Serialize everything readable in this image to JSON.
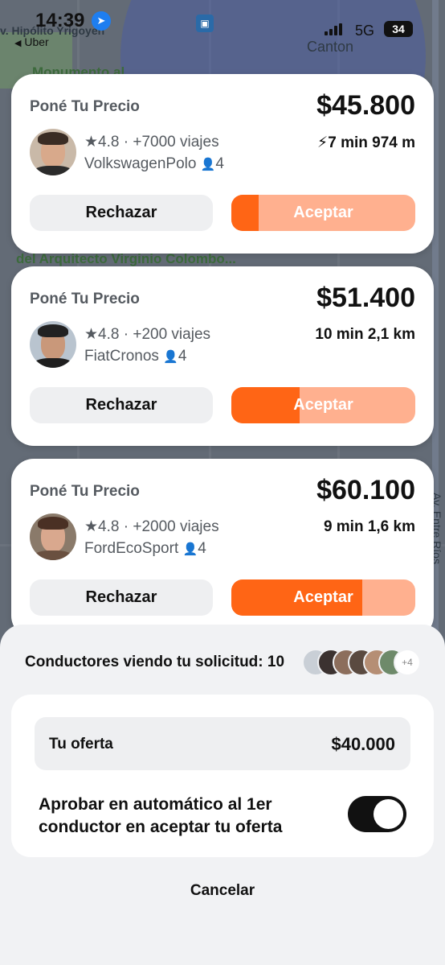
{
  "status_bar": {
    "time": "14:39",
    "back_label": "Uber",
    "network": "5G",
    "battery": "34"
  },
  "map": {
    "labels": {
      "street_top": "v. Hipólito Yrigoyen",
      "canton": "Canton",
      "monument": "Monumento al",
      "architect": "del Arquitecto Virginio Colombo...",
      "av_entre_rios": "Av. Entre Ríos"
    }
  },
  "offers": [
    {
      "title": "Poné Tu Precio",
      "price": "$45.800",
      "rating": "4.8",
      "trips": "+7000 viajes",
      "car": "VolkswagenPolo",
      "seats": "4",
      "eta": "7 min 974 m",
      "eta_flash": true,
      "reject_label": "Rechazar",
      "accept_label": "Aceptar",
      "accept_progress": 0.15
    },
    {
      "title": "Poné Tu Precio",
      "price": "$51.400",
      "rating": "4.8",
      "trips": "+200 viajes",
      "car": "FiatCronos",
      "seats": "4",
      "eta": "10 min 2,1 km",
      "eta_flash": false,
      "reject_label": "Rechazar",
      "accept_label": "Aceptar",
      "accept_progress": 0.37
    },
    {
      "title": "Poné Tu Precio",
      "price": "$60.100",
      "rating": "4.8",
      "trips": "+2000 viajes",
      "car": "FordEcoSport",
      "seats": "4",
      "eta": "9 min 1,6 km",
      "eta_flash": false,
      "reject_label": "Rechazar",
      "accept_label": "Aceptar",
      "accept_progress": 0.71
    }
  ],
  "sheet": {
    "viewers_label": "Conductores viendo tu solicitud: 10",
    "more_count": "+4",
    "offer_label": "Tu oferta",
    "offer_value": "$40.000",
    "auto_approve_label": "Aprobar en automático al 1er conductor en aceptar tu oferta",
    "auto_approve_on": true,
    "cancel_label": "Cancelar"
  },
  "colors": {
    "accent": "#ff6515",
    "accent_light": "#ffb08f",
    "card_bg": "#ffffff",
    "sheet_bg": "#f1f2f4"
  }
}
